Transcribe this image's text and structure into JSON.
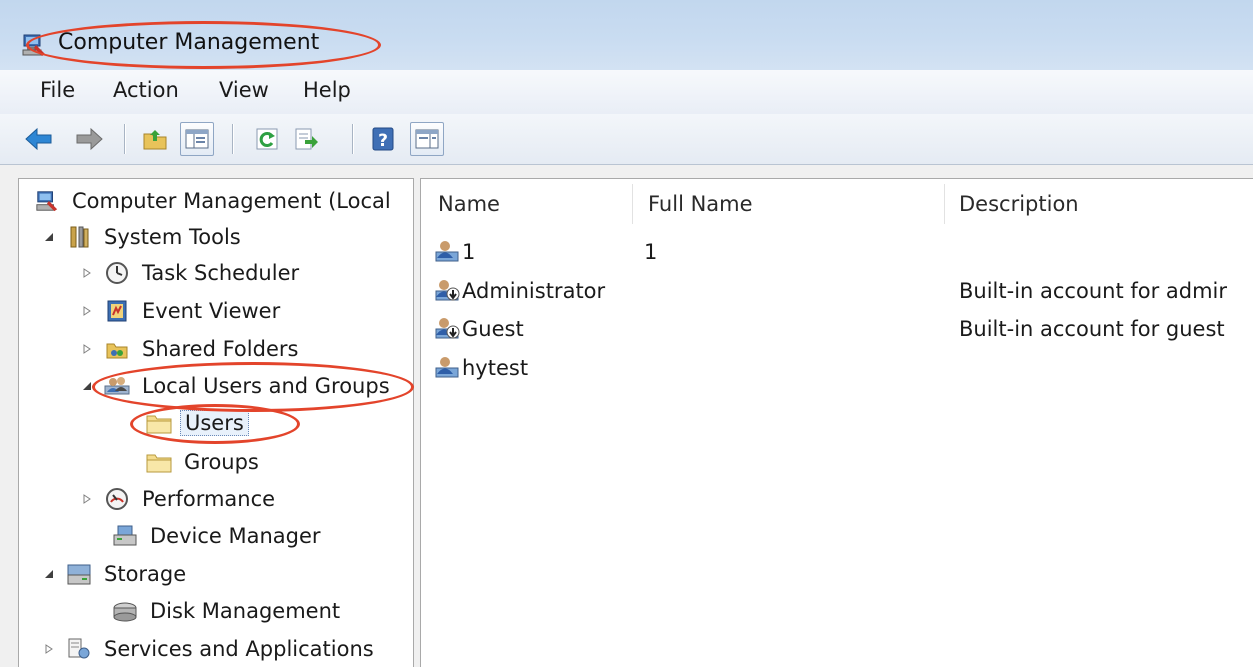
{
  "window": {
    "title": "Computer Management"
  },
  "menu": [
    "File",
    "Action",
    "View",
    "Help"
  ],
  "toolbar": [
    {
      "name": "back-button",
      "icon": "back-arrow-icon"
    },
    {
      "name": "forward-button",
      "icon": "forward-arrow-icon"
    },
    {
      "name": "up-folder-button",
      "icon": "folder-up-icon"
    },
    {
      "name": "show-hide-console-tree-button",
      "icon": "console-tree-icon"
    },
    {
      "name": "refresh-button",
      "icon": "refresh-icon"
    },
    {
      "name": "export-list-button",
      "icon": "export-icon"
    },
    {
      "name": "help-button",
      "icon": "help-icon",
      "glyph": "?"
    },
    {
      "name": "show-hide-action-pane-button",
      "icon": "action-pane-icon"
    }
  ],
  "tree": [
    {
      "label": "Computer Management (Local",
      "icon": "computer-management-icon",
      "expander": "none"
    },
    {
      "label": "System Tools",
      "icon": "system-tools-icon",
      "expander": "expanded"
    },
    {
      "label": "Task Scheduler",
      "icon": "clock-icon",
      "expander": "collapsed"
    },
    {
      "label": "Event Viewer",
      "icon": "event-viewer-icon",
      "expander": "collapsed"
    },
    {
      "label": "Shared Folders",
      "icon": "shared-folders-icon",
      "expander": "collapsed"
    },
    {
      "label": "Local Users and Groups",
      "icon": "users-group-icon",
      "expander": "expanded"
    },
    {
      "label": "Users",
      "icon": "folder-icon",
      "expander": "none",
      "selected": true
    },
    {
      "label": "Groups",
      "icon": "folder-icon",
      "expander": "none"
    },
    {
      "label": "Performance",
      "icon": "performance-gauge-icon",
      "expander": "collapsed"
    },
    {
      "label": "Device Manager",
      "icon": "device-manager-icon",
      "expander": "none"
    },
    {
      "label": "Storage",
      "icon": "storage-icon",
      "expander": "expanded"
    },
    {
      "label": "Disk Management",
      "icon": "disk-icon",
      "expander": "none"
    },
    {
      "label": "Services and Applications",
      "icon": "services-icon",
      "expander": "collapsed"
    }
  ],
  "list": {
    "columns": [
      "Name",
      "Full Name",
      "Description"
    ],
    "rows": [
      {
        "name": "1",
        "full_name": "1",
        "description": "",
        "icon": "user-icon"
      },
      {
        "name": "Administrator",
        "full_name": "",
        "description": "Built-in account for admir",
        "icon": "user-disabled-icon"
      },
      {
        "name": "Guest",
        "full_name": "",
        "description": "Built-in account for guest",
        "icon": "user-disabled-icon"
      },
      {
        "name": "hytest",
        "full_name": "",
        "description": "",
        "icon": "user-icon"
      }
    ]
  },
  "colors": {
    "annotation": "#e3442b",
    "titlebar": "#c9dcf1",
    "selection_border": "#6a89b8"
  }
}
